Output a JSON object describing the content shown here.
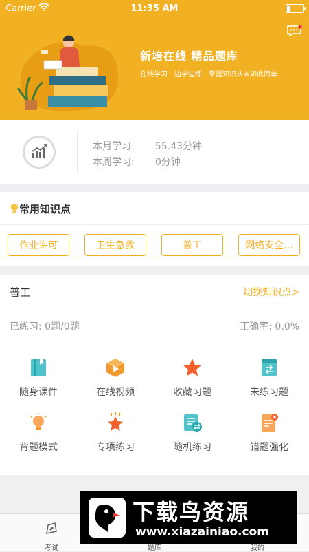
{
  "status_bar": {
    "carrier": "Carrier",
    "time": "11:35 AM"
  },
  "hero": {
    "title": "新培在线 精品题库",
    "subtitle": "在线学习　边学边练　掌握知识从未如此简单",
    "accent_color": "#f2b023"
  },
  "stats": {
    "month_label": "本月学习:",
    "month_value": "55.43分钟",
    "week_label": "本周学习:",
    "week_value": "0分钟"
  },
  "knowledge_points": {
    "heading": "常用知识点",
    "items": [
      "作业许可",
      "卫生急救",
      "普工",
      "网络安全..."
    ]
  },
  "practice": {
    "title": "普工",
    "switch_label": "切换知识点>",
    "practiced": "已练习: 0题/0题",
    "accuracy": "正确率: 0.0%",
    "features": [
      {
        "label": "随身课件",
        "icon": "book-icon"
      },
      {
        "label": "在线视频",
        "icon": "video-icon"
      },
      {
        "label": "收藏习题",
        "icon": "star-icon"
      },
      {
        "label": "未练习题",
        "icon": "unpracticed-icon"
      },
      {
        "label": "背题模式",
        "icon": "lightbulb-icon"
      },
      {
        "label": "专项练习",
        "icon": "special-star-icon"
      },
      {
        "label": "随机练习",
        "icon": "random-icon"
      },
      {
        "label": "错题强化",
        "icon": "wrong-question-icon"
      }
    ]
  },
  "tabbar": {
    "tabs": [
      "考试",
      "题库",
      "我的"
    ]
  },
  "watermark": {
    "line1": "下载鸟资源",
    "line2": "www.xiazainiao.com"
  }
}
